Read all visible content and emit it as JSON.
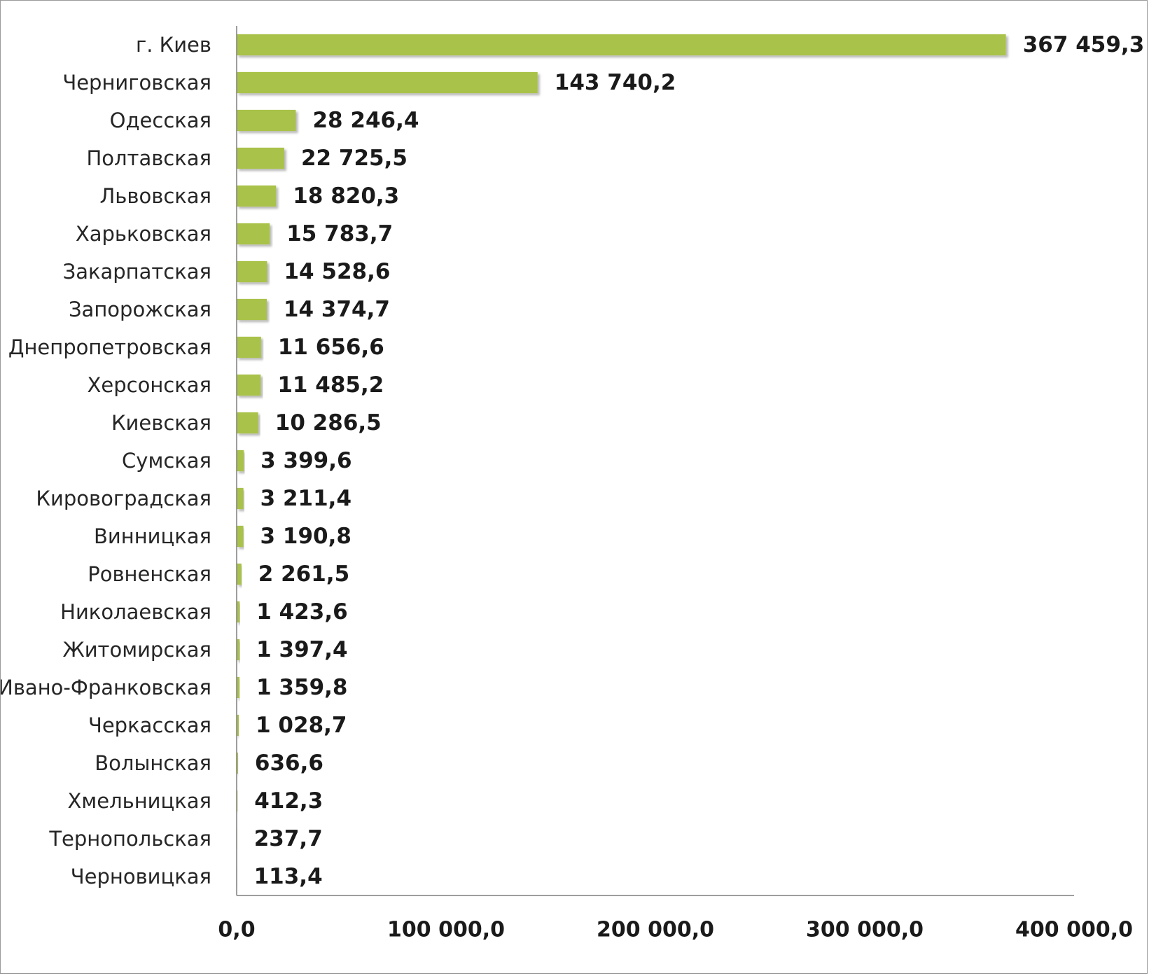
{
  "chart_data": {
    "type": "bar",
    "orientation": "horizontal",
    "categories": [
      "г. Киев",
      "Черниговская",
      "Одесская",
      "Полтавская",
      "Львовская",
      "Харьковская",
      "Закарпатская",
      "Запорожская",
      "Днепропетровская",
      "Херсонская",
      "Киевская",
      "Сумская",
      "Кировоградская",
      "Винницкая",
      "Ровненская",
      "Николаевская",
      "Житомирская",
      "Ивано-Франковская",
      "Черкасская",
      "Волынская",
      "Хмельницкая",
      "Тернопольская",
      "Черновицкая"
    ],
    "values": [
      367459.3,
      143740.2,
      28246.4,
      22725.5,
      18820.3,
      15783.7,
      14528.6,
      14374.7,
      11656.6,
      11485.2,
      10286.5,
      3399.6,
      3211.4,
      3190.8,
      2261.5,
      1423.6,
      1397.4,
      1359.8,
      1028.7,
      636.6,
      412.3,
      237.7,
      113.4
    ],
    "value_labels": [
      "367 459,3",
      "143 740,2",
      "28 246,4",
      "22 725,5",
      "18 820,3",
      "15 783,7",
      "14 528,6",
      "14 374,7",
      "11 656,6",
      "11 485,2",
      "10 286,5",
      "3 399,6",
      "3 211,4",
      "3 190,8",
      "2 261,5",
      "1 423,6",
      "1 397,4",
      "1 359,8",
      "1 028,7",
      "636,6",
      "412,3",
      "237,7",
      "113,4"
    ],
    "xlim": [
      0,
      400000
    ],
    "x_ticks": [
      0,
      100000,
      200000,
      300000,
      400000
    ],
    "x_tick_labels": [
      "0,0",
      "100 000,0",
      "200 000,0",
      "300 000,0",
      "400 000,0"
    ],
    "grid": false,
    "legend": "none",
    "bar_color": "#a9c24a",
    "axis_color": "#7f7f7f"
  }
}
